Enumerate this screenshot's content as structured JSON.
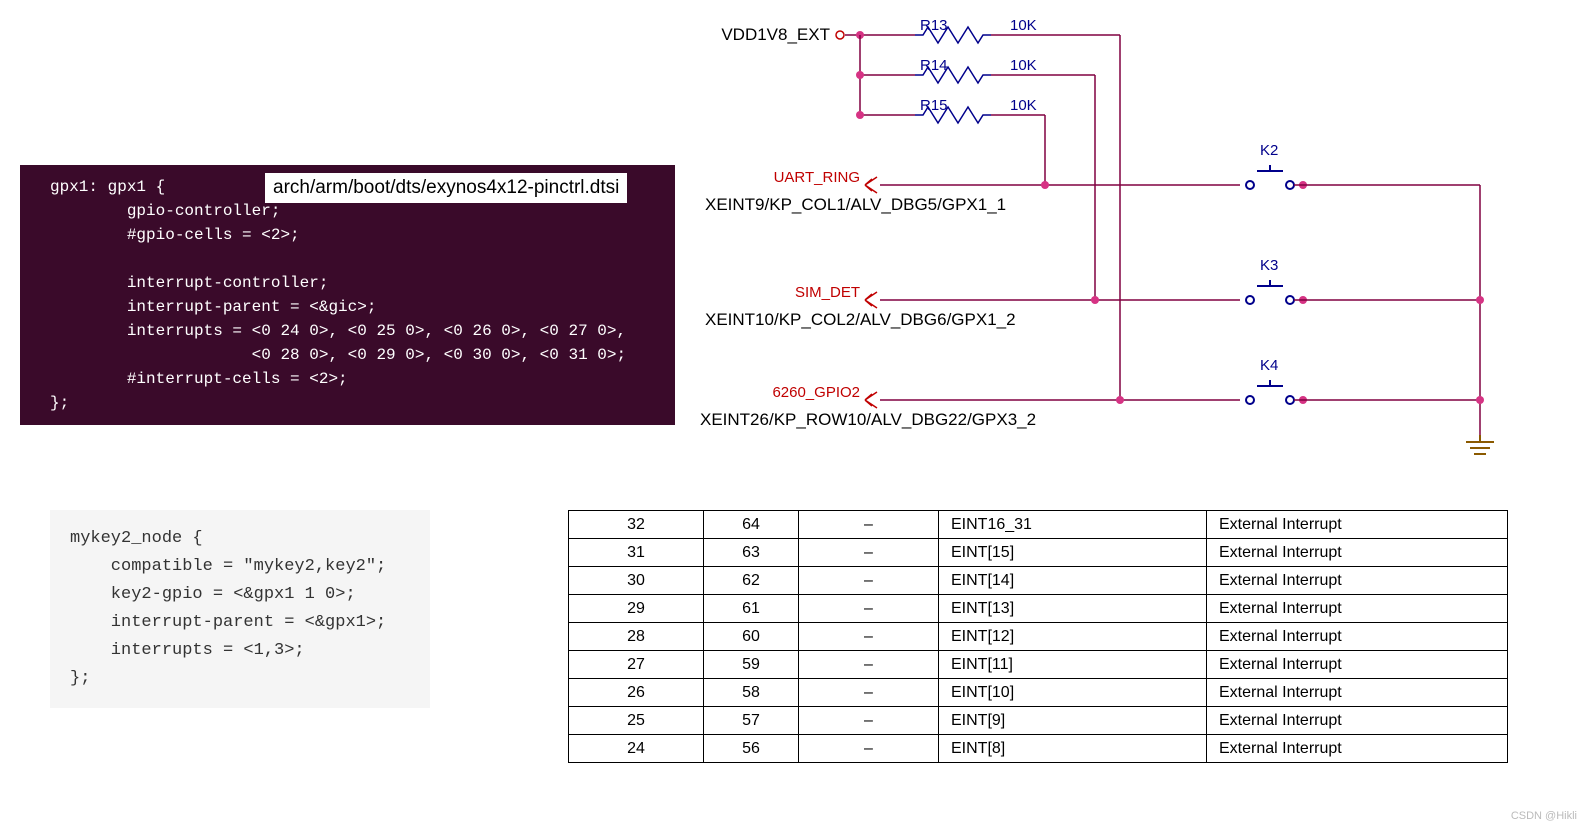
{
  "code1": {
    "path": "arch/arm/boot/dts/exynos4x12-pinctrl.dtsi",
    "l1": "gpx1: gpx1 {",
    "l2": "        gpio-controller;",
    "l3": "        #gpio-cells = <2>;",
    "blank1": "",
    "l4": "        interrupt-controller;",
    "l5": "        interrupt-parent = <&gic>;",
    "l6": "        interrupts = <0 24 0>, <0 25 0>, <0 26 0>, <0 27 0>,",
    "l7": "                     <0 28 0>, <0 29 0>, <0 30 0>, <0 31 0>;",
    "l8": "        #interrupt-cells = <2>;",
    "l9": "};"
  },
  "code2": {
    "l1": "mykey2_node {",
    "l2": "    compatible = \"mykey2,key2\";",
    "l3": "    key2-gpio = <&gpx1 1 0>;",
    "l4": "    interrupt-parent = <&gpx1>;",
    "l5": "    interrupts = <1,3>;",
    "l6": "};"
  },
  "schematic": {
    "vdd": "VDD1V8_EXT",
    "r13": "R13",
    "r13v": "10K",
    "r14": "R14",
    "r14v": "10K",
    "r15": "R15",
    "r15v": "10K",
    "k2": "K2",
    "k3": "K3",
    "k4": "K4",
    "net1": "UART_RING",
    "pin1": "XEINT9/KP_COL1/ALV_DBG5/GPX1_1",
    "net2": "SIM_DET",
    "pin2": "XEINT10/KP_COL2/ALV_DBG6/GPX1_2",
    "net3": "6260_GPIO2",
    "pin3": "XEINT26/KP_ROW10/ALV_DBG22/GPX3_2"
  },
  "table": [
    {
      "c1": "32",
      "c2": "64",
      "c3": "–",
      "c4": "EINT16_31",
      "c5": "External Interrupt"
    },
    {
      "c1": "31",
      "c2": "63",
      "c3": "–",
      "c4": "EINT[15]",
      "c5": "External Interrupt"
    },
    {
      "c1": "30",
      "c2": "62",
      "c3": "–",
      "c4": "EINT[14]",
      "c5": "External Interrupt"
    },
    {
      "c1": "29",
      "c2": "61",
      "c3": "–",
      "c4": "EINT[13]",
      "c5": "External Interrupt"
    },
    {
      "c1": "28",
      "c2": "60",
      "c3": "–",
      "c4": "EINT[12]",
      "c5": "External Interrupt"
    },
    {
      "c1": "27",
      "c2": "59",
      "c3": "–",
      "c4": "EINT[11]",
      "c5": "External Interrupt"
    },
    {
      "c1": "26",
      "c2": "58",
      "c3": "–",
      "c4": "EINT[10]",
      "c5": "External Interrupt"
    },
    {
      "c1": "25",
      "c2": "57",
      "c3": "–",
      "c4": "EINT[9]",
      "c5": "External Interrupt"
    },
    {
      "c1": "24",
      "c2": "56",
      "c3": "–",
      "c4": "EINT[8]",
      "c5": "External Interrupt"
    }
  ],
  "watermark": "CSDN @Hikli"
}
